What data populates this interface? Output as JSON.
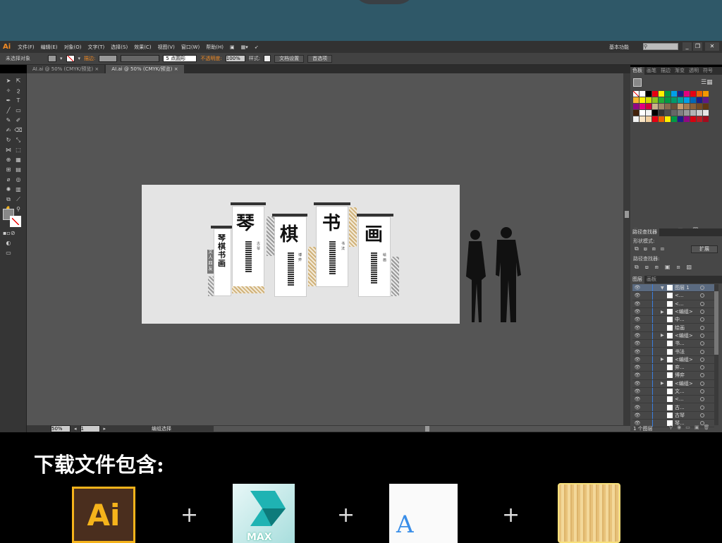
{
  "app": {
    "logo": "Ai",
    "menu": [
      "文件(F)",
      "编辑(E)",
      "对象(O)",
      "文字(T)",
      "选择(S)",
      "效果(C)",
      "视图(V)",
      "窗口(W)",
      "帮助(H)"
    ],
    "workspace": "基本功能",
    "search_placeholder": "",
    "window_buttons": [
      "_",
      "❐",
      "✕"
    ]
  },
  "control": {
    "selection": "未选择对象",
    "stroke_label": "描边:",
    "brush": "5 点圆形",
    "opacity_label": "不透明度:",
    "opacity": "100%",
    "style_label": "样式:",
    "doc_setup": "文档设置",
    "preferences": "首选项"
  },
  "tabs": [
    {
      "label": "AI.ai @ 50% (CMYK/预览)",
      "close": "×"
    },
    {
      "label": "AI.ai @ 50% (CMYK/预览)",
      "close": "×",
      "active": true
    }
  ],
  "artwork": {
    "big_chars": [
      "琴",
      "棋",
      "书",
      "画"
    ],
    "side_title": "琴棋书画",
    "badge": "文人四友",
    "small_labels": [
      "古琴",
      "博弈",
      "书法",
      "绘画"
    ]
  },
  "status": {
    "zoom": "50%",
    "page": "1",
    "tool": "编组选择"
  },
  "swatches_panel": {
    "tabs": [
      "色板",
      "画笔",
      "描边",
      "渐变",
      "透明",
      "符号"
    ],
    "colors": [
      "#ffffff",
      "#000000",
      "#e60012",
      "#fff100",
      "#009944",
      "#00a0e9",
      "#1d2088",
      "#e4007f",
      "#e60012",
      "#eb6100",
      "#f39800",
      "#f8b62d",
      "#fff100",
      "#cfdb00",
      "#8fc31f",
      "#22ac38",
      "#009944",
      "#009b6b",
      "#00a29a",
      "#00a0e9",
      "#0068b7",
      "#1d2088",
      "#601986",
      "#920783",
      "#e4007f",
      "#d7003a",
      "#c9b38b",
      "#a08868",
      "#886a4e",
      "#6b5038",
      "#c69c6d",
      "#a67c52",
      "#8c6239",
      "#754c24",
      "#603913",
      "#42210b",
      "#ffffff",
      "#f2f2f2",
      "#000000",
      "#333333",
      "#4d4d4d",
      "#666666",
      "#808080",
      "#999999",
      "#b3b3b3",
      "#cccccc",
      "#e6e6e6",
      "#f2f2f2",
      "#fbe6c6",
      "#f0cfa0",
      "#e60012",
      "#eb6100",
      "#fff100",
      "#009944",
      "#1d2088",
      "#920783",
      "#d7000f",
      "#b81c22",
      "#a40b1d"
    ]
  },
  "pathfinder": {
    "title": "路径查找器",
    "shape_modes": "形状模式:",
    "expand": "扩展",
    "finders": "路径查找器:"
  },
  "layers_panel": {
    "tabs": [
      "图层",
      "画板"
    ],
    "count": "1 个图层",
    "rows": [
      {
        "name": "图层 1",
        "top": true
      },
      {
        "name": "<..."
      },
      {
        "name": "<..."
      },
      {
        "name": "<编组>",
        "group": true
      },
      {
        "name": "中..."
      },
      {
        "name": "绘画"
      },
      {
        "name": "<编组>",
        "group": true
      },
      {
        "name": "书..."
      },
      {
        "name": "书法"
      },
      {
        "name": "<编组>",
        "group": true
      },
      {
        "name": "弈..."
      },
      {
        "name": "博弈"
      },
      {
        "name": "<编组>",
        "group": true
      },
      {
        "name": "文..."
      },
      {
        "name": "<..."
      },
      {
        "name": "古..."
      },
      {
        "name": "古琴"
      },
      {
        "name": "琴..."
      }
    ]
  },
  "footer": {
    "heading": "下载文件包含:",
    "plus": "+",
    "icons": [
      {
        "label": "Ai"
      },
      {
        "label": "MAX"
      },
      {
        "label": "A"
      }
    ]
  },
  "colors": {
    "accent": "#f08a24",
    "ai_yellow": "#f5b31b",
    "layer_blue": "#3a7fe0"
  }
}
